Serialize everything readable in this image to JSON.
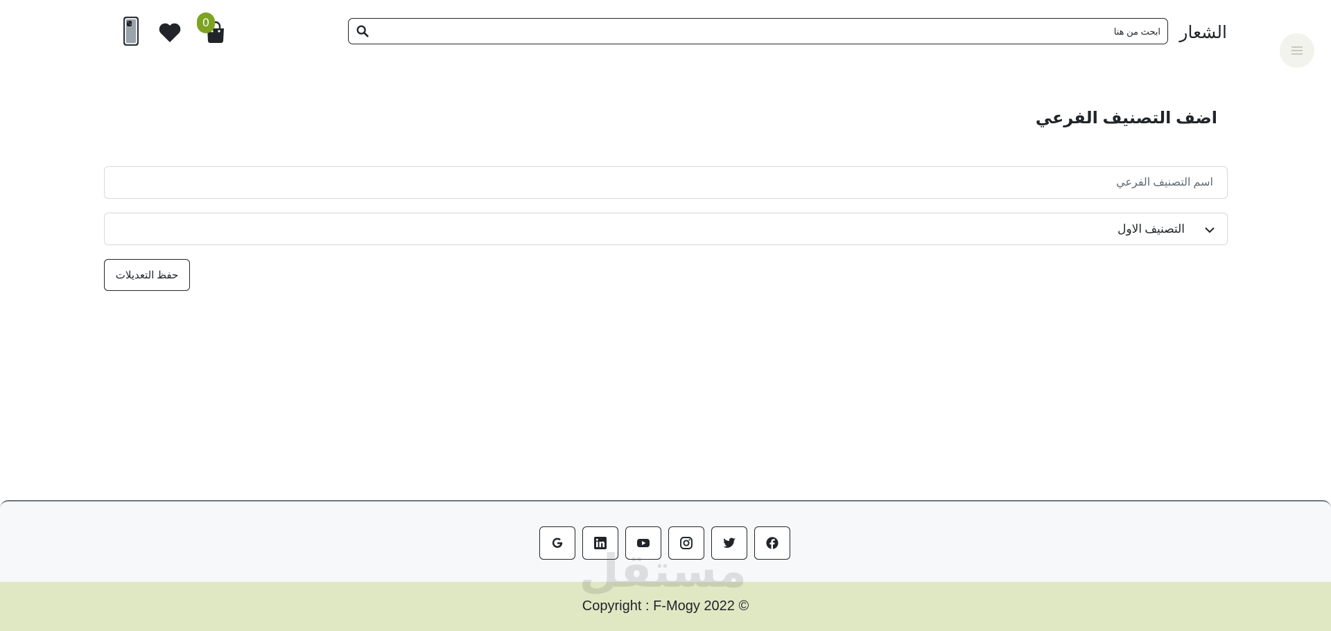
{
  "header": {
    "brand": "الشعار",
    "search_placeholder": "ابحث من هنا",
    "cart_count": "0",
    "icons": {
      "menu": "menu-icon",
      "search": "search-icon",
      "cart": "shopping-bag-icon",
      "wishlist": "heart-icon",
      "profile": "phone-image"
    }
  },
  "main": {
    "title": "اضف التصنيف الفرعي",
    "name_placeholder": "اسم التصنيف الفرعي",
    "category_selected": "التصنيف الاول",
    "save_label": "حفظ التعديلات"
  },
  "footer": {
    "socials": [
      "google-icon",
      "linkedin-icon",
      "youtube-icon",
      "instagram-icon",
      "twitter-icon",
      "facebook-icon"
    ],
    "copyright": "Copyright : F-Mogy 2022 ©",
    "watermark": "مستقل"
  },
  "colors": {
    "badge": "#7da321",
    "copyright_bar": "#dfe8c3",
    "footer_bg": "#f7f8fa",
    "menu_circle": "#f2f3ec"
  }
}
